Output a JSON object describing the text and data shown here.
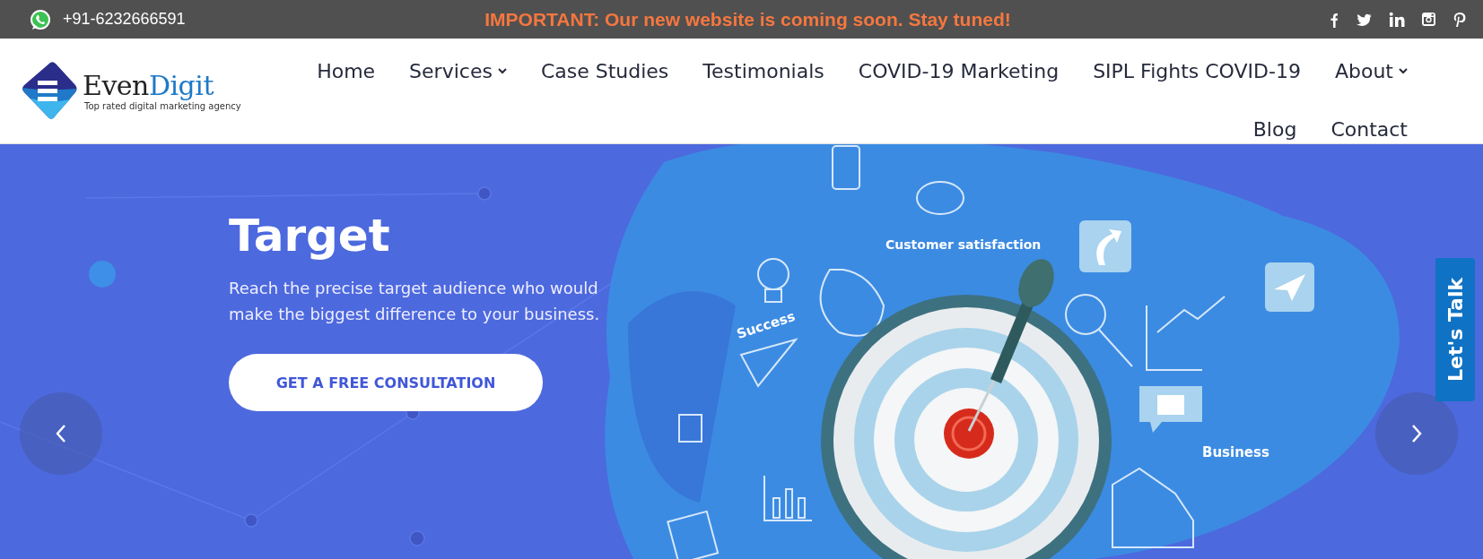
{
  "top_bar": {
    "phone": "+91-6232666591",
    "announcement": "IMPORTANT: Our new website is coming soon. Stay tuned!"
  },
  "header": {
    "logo": {
      "wordmark": [
        "Even",
        "Digit"
      ],
      "tagline": "Top rated digital marketing agency"
    },
    "nav": [
      {
        "label": "Home",
        "has_dropdown": false
      },
      {
        "label": "Services",
        "has_dropdown": true
      },
      {
        "label": "Case Studies",
        "has_dropdown": false
      },
      {
        "label": "Testimonials",
        "has_dropdown": false
      },
      {
        "label": "COVID-19 Marketing",
        "has_dropdown": false
      },
      {
        "label": "SIPL Fights COVID-19",
        "has_dropdown": false
      },
      {
        "label": "About",
        "has_dropdown": true
      },
      {
        "label": "Blog",
        "has_dropdown": false
      },
      {
        "label": "Contact",
        "has_dropdown": false
      }
    ]
  },
  "hero": {
    "title": "Target",
    "description": "Reach the precise target audience who would make the biggest difference to your business.",
    "button": "GET A FREE CONSULTATION",
    "illustration_labels": [
      "Customer satisfaction",
      "Success",
      "Business"
    ]
  },
  "side_tab": {
    "label": "Let's Talk"
  }
}
